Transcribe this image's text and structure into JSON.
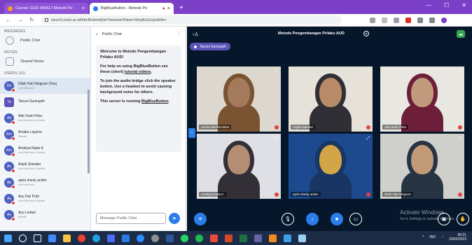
{
  "browser": {
    "tabs": [
      {
        "title": "Course: GUO 340417-Metode Pe",
        "active": false,
        "favicon_color": "#f4a21c"
      },
      {
        "title": "BigBlueButton - Metode Pe",
        "active": true,
        "favicon_color": "#2b7de9"
      }
    ],
    "new_tab_label": "+",
    "url": "vicon3.unsri.ac.id/html5client/join?sessionToken=9mq6z2a1pnkl4ec"
  },
  "sidebar": {
    "messages_title": "MESSAGES",
    "public_chat_label": "Public Chat",
    "notes_title": "NOTES",
    "shared_notes_label": "Shared Notes",
    "users_title": "USERS (51)",
    "users": [
      {
        "initials": "Dh",
        "name": "Dilah Hati Ningrum (You)",
        "sub": "via WebCam",
        "highlight": true,
        "color": "#4d61c1",
        "square": false
      },
      {
        "initials": "Ta",
        "name": "Tanuni Suningsih",
        "sub": "",
        "highlight": false,
        "color": "#5b53b7",
        "square": true
      },
      {
        "initials": "Ad",
        "name": "Ade Desti Fitria",
        "sub": "via WebCam | Mobile",
        "highlight": false,
        "color": "#4d61c1",
        "square": false
      },
      {
        "initials": "Am",
        "name": "Amalia Layyina",
        "sub": "Mobile",
        "highlight": false,
        "color": "#4d61c1",
        "square": false
      },
      {
        "initials": "Am",
        "name": "Ameliya Nada K.",
        "sub": "via WebCam | Mobile",
        "highlight": false,
        "color": "#4d61c1",
        "square": false
      },
      {
        "initials": "An",
        "name": "Anjeli Ulandari",
        "sub": "via WebCam | Mobile",
        "highlight": false,
        "color": "#4d61c1",
        "square": false
      },
      {
        "initials": "Ap",
        "name": "apria sherly andini",
        "sub": "via WebCam",
        "highlight": false,
        "color": "#4d61c1",
        "square": false
      },
      {
        "initials": "Ay",
        "name": "Ayu Dwi Putri",
        "sub": "via WebCam | Mobile",
        "highlight": false,
        "color": "#4d61c1",
        "square": false
      },
      {
        "initials": "Ay",
        "name": "Ayu Lestari",
        "sub": "Mobile",
        "highlight": false,
        "color": "#4d61c1",
        "square": false
      }
    ]
  },
  "chat": {
    "header": "Public Chat",
    "welcome_1": "Welcome to Metode Pengembangan Prilaku AUD!",
    "welcome_2a": "For help on using BigBlueButton see these (short) ",
    "welcome_2b": "tutorial videos",
    "welcome_2c": ".",
    "welcome_3": "To join the audio bridge click the speaker button. Use a headset to avoid causing background noise for others.",
    "welcome_4a": "This server is running ",
    "welcome_4b": "BigBlueButton",
    "welcome_4c": ".",
    "input_placeholder": "Message Public Chat"
  },
  "meeting": {
    "title": "Metode Pengembangan Prilaku AUD",
    "presenter": "Tanuni Suningsih",
    "tiles": [
      {
        "name": "Serda Mardhot Bina",
        "wall": "#ddd8cf",
        "skin": "#a37a5c",
        "cloth": "#7a5432"
      },
      {
        "name": "Anjeli Ulandari",
        "wall": "#e6e1d9",
        "skin": "#b88a68",
        "cloth": "#2f2f35"
      },
      {
        "name": "Ade Desti Fitria",
        "wall": "#e8e7e1",
        "skin": "#c19a7e",
        "cloth": "#6d1f3a"
      },
      {
        "name": "Ameliya Nada K.",
        "wall": "#dfe0e5",
        "skin": "#b48d72",
        "cloth": "#323036"
      },
      {
        "name": "apria sherly andini",
        "wall": "#1d4a8f",
        "skin": "#d2a548",
        "cloth": "#193563"
      },
      {
        "name": "Dilah Hati Ningrum",
        "wall": "#cfcfcb",
        "skin": "#c29a78",
        "cloth": "#273444"
      }
    ],
    "watermark_line1": "Activate Windows",
    "watermark_line2": "Go to Settings to activate Windows."
  },
  "taskbar": {
    "time": "08.31",
    "date": "15/02/2023",
    "tray_lang": "IND"
  }
}
